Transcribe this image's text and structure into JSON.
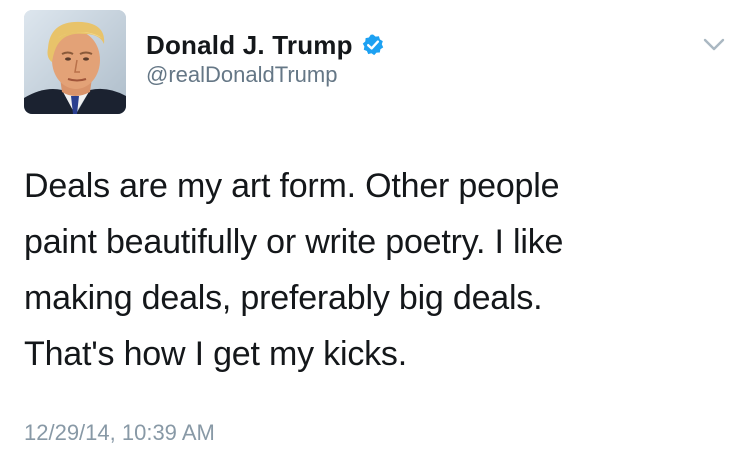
{
  "author": {
    "display_name": "Donald J. Trump",
    "handle": "@realDonaldTrump",
    "verified": true,
    "avatar_icon": "profile-photo"
  },
  "tweet": {
    "text": "Deals are my art form. Other people\npaint beautifully or write poetry. I like\nmaking deals, preferably big deals.\nThat's how I get my kicks.",
    "timestamp": "12/29/14, 10:39 AM"
  },
  "controls": {
    "menu_icon": "chevron-down-icon"
  },
  "colors": {
    "verified_blue": "#1da1f2",
    "name_text": "#14171a",
    "handle_text": "#657786",
    "timestamp_text": "#8899a6",
    "chevron": "#aab8c2",
    "background": "#ffffff"
  }
}
